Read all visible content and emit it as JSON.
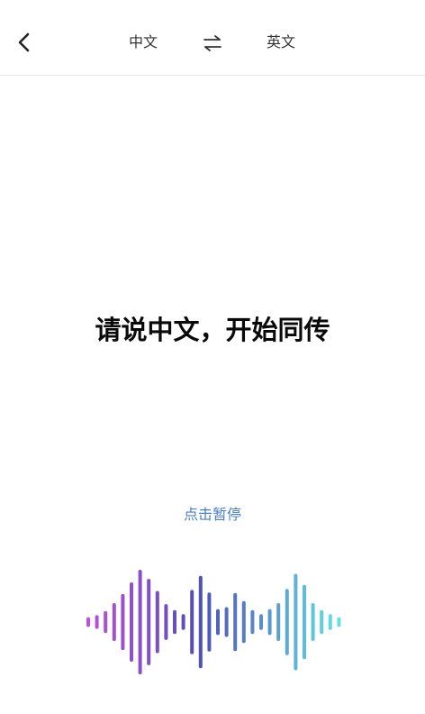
{
  "header": {
    "source_language": "中文",
    "target_language": "英文",
    "back_icon": "chevron-left-icon",
    "swap_icon": "swap-arrows-icon"
  },
  "main": {
    "prompt": "请说中文，开始同传",
    "pause_label": "点击暂停"
  },
  "waveform": {
    "gradient": [
      "#c04fd6",
      "#4f4fb8",
      "#62e0e6"
    ],
    "levels": [
      0.06,
      0.1,
      0.18,
      0.34,
      0.52,
      0.75,
      1.0,
      0.82,
      0.58,
      0.32,
      0.2,
      0.12,
      0.6,
      0.88,
      0.55,
      0.22,
      0.26,
      0.54,
      0.38,
      0.2,
      0.12,
      0.22,
      0.34,
      0.62,
      0.92,
      0.7,
      0.34,
      0.2,
      0.12,
      0.06
    ]
  },
  "colors": {
    "accent": "#4a7fc0",
    "divider": "#e6e6e6"
  }
}
